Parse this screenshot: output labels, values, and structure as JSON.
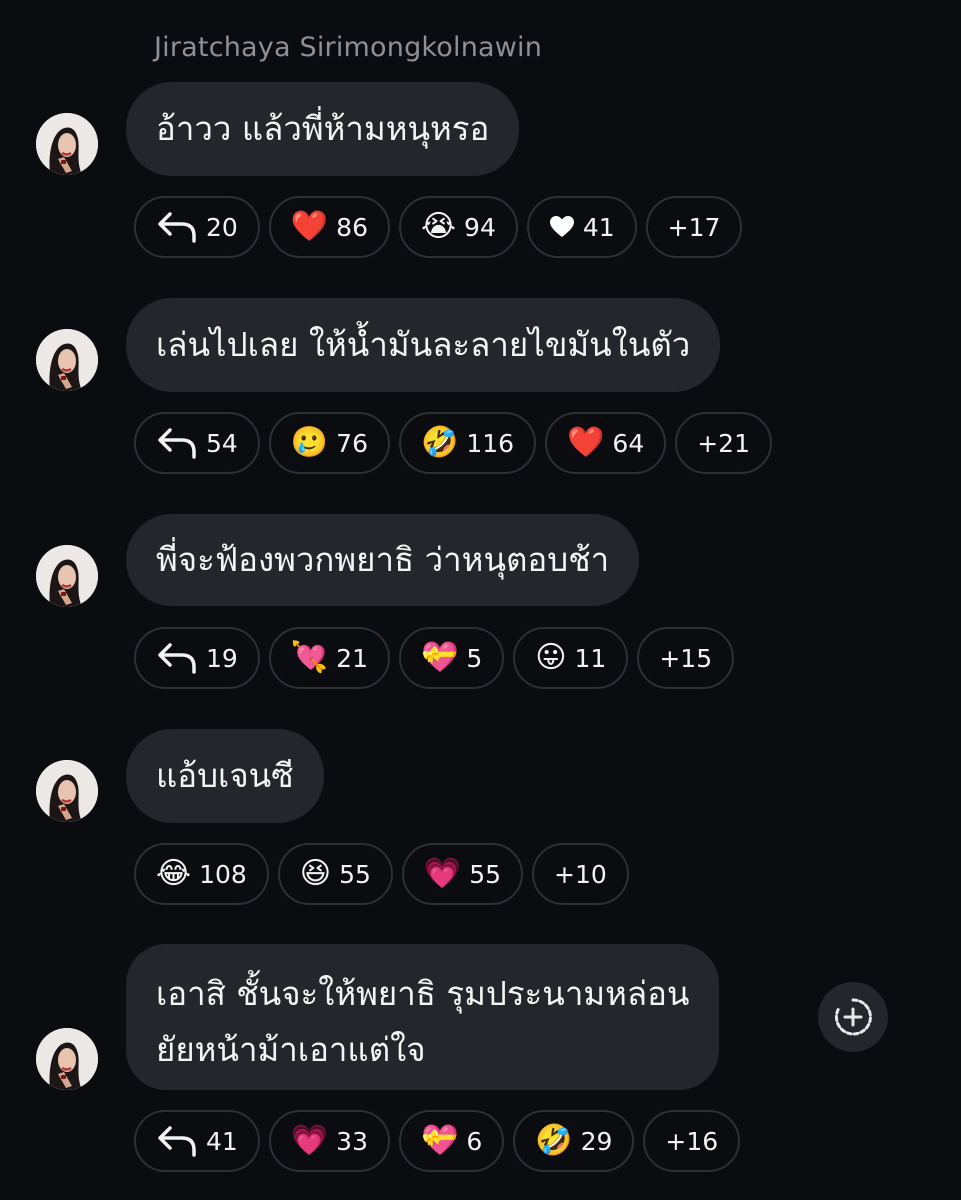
{
  "sender_name": "Jiratchaya Sirimongkolnawin",
  "messages": [
    {
      "text": "อ้าวว แล้วพี่ห้ามหนุหรอ",
      "reactions": [
        {
          "type": "reply",
          "icon": "reply-arrow-icon",
          "count": "20"
        },
        {
          "type": "emoji",
          "icon": "red-heart-icon",
          "emoji": "❤️",
          "count": "86"
        },
        {
          "type": "emoji",
          "icon": "loudly-crying-face-icon",
          "emoji": "😭",
          "count": "94"
        },
        {
          "type": "emoji",
          "icon": "white-heart-icon",
          "emoji": "♥",
          "count": "41"
        },
        {
          "type": "more",
          "count": "+17"
        }
      ]
    },
    {
      "text": "เล่นไปเลย ให้น้ำมันละลายไขมันในตัว",
      "reactions": [
        {
          "type": "reply",
          "icon": "reply-arrow-icon",
          "count": "54"
        },
        {
          "type": "emoji",
          "icon": "sad-tear-face-icon",
          "emoji": "🥲",
          "count": "76"
        },
        {
          "type": "emoji",
          "icon": "rolling-laughing-face-icon",
          "emoji": "🤣",
          "count": "116"
        },
        {
          "type": "emoji",
          "icon": "red-heart-icon",
          "emoji": "❤️",
          "count": "64"
        },
        {
          "type": "more",
          "count": "+21"
        }
      ]
    },
    {
      "text": "พี่จะฟ้องพวกพยาธิ ว่าหนุตอบช้า",
      "reactions": [
        {
          "type": "reply",
          "icon": "reply-arrow-icon",
          "count": "19"
        },
        {
          "type": "emoji",
          "icon": "heart-with-arrow-icon",
          "emoji": "💘",
          "count": "21"
        },
        {
          "type": "emoji",
          "icon": "heart-with-ribbon-icon",
          "emoji": "💝",
          "count": "5"
        },
        {
          "type": "emoji",
          "icon": "tongue-face-icon",
          "emoji": "😛",
          "count": "11"
        },
        {
          "type": "more",
          "count": "+15"
        }
      ]
    },
    {
      "text": "แอ้บเจนซี",
      "reactions": [
        {
          "type": "emoji",
          "icon": "tears-of-joy-face-icon",
          "emoji": "😂",
          "count": "108"
        },
        {
          "type": "emoji",
          "icon": "squinting-laughing-face-icon",
          "emoji": "😆",
          "count": "55"
        },
        {
          "type": "emoji",
          "icon": "growing-heart-icon",
          "emoji": "💗",
          "count": "55"
        },
        {
          "type": "more",
          "count": "+10"
        }
      ]
    },
    {
      "lines": [
        "เอาสิ ชั้นจะให้พยาธิ รุมประนามหล่อน",
        "ยัยหน้าม้าเอาแต่ใจ"
      ],
      "reactions": [
        {
          "type": "reply",
          "icon": "reply-arrow-icon",
          "count": "41"
        },
        {
          "type": "emoji",
          "icon": "pink-heart-icon",
          "emoji": "💗",
          "count": "33"
        },
        {
          "type": "emoji",
          "icon": "heart-with-ribbon-icon",
          "emoji": "💝",
          "count": "6"
        },
        {
          "type": "emoji",
          "icon": "rolling-laughing-face-icon",
          "emoji": "🤣",
          "count": "29"
        },
        {
          "type": "more",
          "count": "+16"
        }
      ],
      "add_reaction_icon": "add-reaction-icon"
    }
  ],
  "colors": {
    "background": "#0b0c10",
    "bubble": "#25262b",
    "pill_border": "#2e2f35",
    "sender_text": "#8e8f97"
  }
}
